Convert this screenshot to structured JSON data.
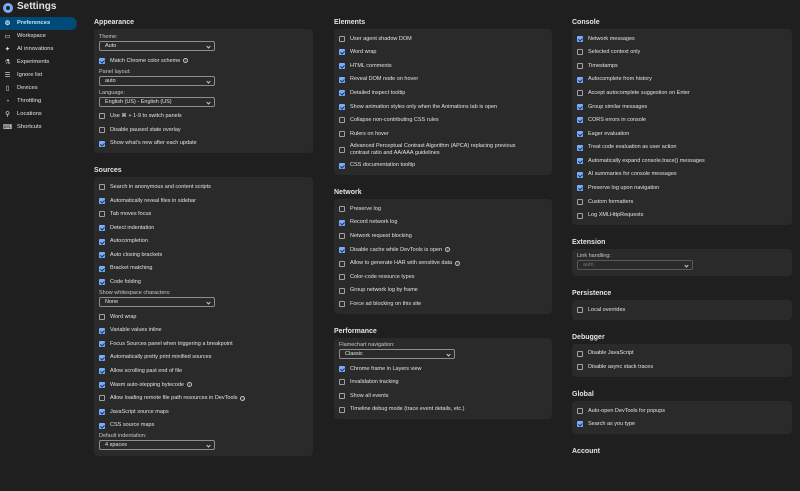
{
  "header": {
    "title": "Settings"
  },
  "sidebar": {
    "items": [
      {
        "label": "Preferences",
        "icon": "gear-icon",
        "glyph": "⚙"
      },
      {
        "label": "Workspace",
        "icon": "folder-icon",
        "glyph": "▭"
      },
      {
        "label": "AI innovations",
        "icon": "sparkle-icon",
        "glyph": "✦"
      },
      {
        "label": "Experiments",
        "icon": "flask-icon",
        "glyph": "⚗"
      },
      {
        "label": "Ignore list",
        "icon": "list-icon",
        "glyph": "☰"
      },
      {
        "label": "Devices",
        "icon": "devices-icon",
        "glyph": "▯"
      },
      {
        "label": "Throttling",
        "icon": "speedometer-icon",
        "glyph": "◔"
      },
      {
        "label": "Locations",
        "icon": "pin-icon",
        "glyph": "⚲"
      },
      {
        "label": "Shortcuts",
        "icon": "keyboard-icon",
        "glyph": "⌨"
      }
    ]
  },
  "appearance": {
    "title": "Appearance",
    "theme_label": "Theme:",
    "theme_value": "Auto",
    "match_chrome": "Match Chrome color scheme",
    "panel_layout_label": "Panel layout:",
    "panel_layout_value": "auto",
    "language_label": "Language:",
    "language_value": "English (US) - English (US)",
    "items": [
      {
        "label": "Use ⌘ + 1-9 to switch panels",
        "checked": false
      },
      {
        "label": "Disable paused state overlay",
        "checked": false
      },
      {
        "label": "Show what's new after each update",
        "checked": true
      }
    ]
  },
  "sources": {
    "title": "Sources",
    "items": [
      {
        "label": "Search in anonymous and content scripts",
        "checked": false
      },
      {
        "label": "Automatically reveal files in sidebar",
        "checked": true
      },
      {
        "label": "Tab moves focus",
        "checked": false
      },
      {
        "label": "Detect indentation",
        "checked": true
      },
      {
        "label": "Autocompletion",
        "checked": true
      },
      {
        "label": "Auto closing brackets",
        "checked": true
      },
      {
        "label": "Bracket matching",
        "checked": true
      },
      {
        "label": "Code folding",
        "checked": true
      }
    ],
    "whitespace_label": "Show whitespace characters:",
    "whitespace_value": "None",
    "items2": [
      {
        "label": "Word wrap",
        "checked": false
      },
      {
        "label": "Variable values inline",
        "checked": true
      },
      {
        "label": "Focus Sources panel when triggering a breakpoint",
        "checked": true
      },
      {
        "label": "Automatically pretty print minified sources",
        "checked": true
      },
      {
        "label": "Allow scrolling past end of file",
        "checked": true
      }
    ],
    "wasm": "Wasm auto-stepping bytecode",
    "remote": "Allow loading remote file path resources in DevTools",
    "items3": [
      {
        "label": "JavaScript source maps",
        "checked": true
      },
      {
        "label": "CSS source maps",
        "checked": true
      }
    ],
    "indent_label": "Default indentation:",
    "indent_value": "4 spaces"
  },
  "elements": {
    "title": "Elements",
    "items": [
      {
        "label": "User agent shadow DOM",
        "checked": false
      },
      {
        "label": "Word wrap",
        "checked": true
      },
      {
        "label": "HTML comments",
        "checked": true
      },
      {
        "label": "Reveal DOM node on hover",
        "checked": true
      },
      {
        "label": "Detailed inspect tooltip",
        "checked": true
      },
      {
        "label": "Show animation styles only when the Animations tab is open",
        "checked": true
      },
      {
        "label": "Collapse non-contributing CSS rules",
        "checked": false
      },
      {
        "label": "Rulers on hover",
        "checked": false
      }
    ],
    "apca": "Advanced Perceptual Contrast Algorithm (APCA) replacing previous contrast ratio and AA/AAA guidelines",
    "css_doc": "CSS documentation tooltip"
  },
  "network": {
    "title": "Network",
    "preserve": "Preserve log",
    "record": "Record network log",
    "blocking": "Network request blocking",
    "cache": "Disable cache while DevTools is open",
    "har": "Allow to generate HAR with sensitive data",
    "color": "Color-code resource types",
    "group": "Group network log by frame",
    "force": "Force ad blocking on this site"
  },
  "performance": {
    "title": "Performance",
    "flame_label": "Flamechart navigation:",
    "flame_value": "Classic",
    "items": [
      {
        "label": "Chrome frame in Layers view",
        "checked": true
      },
      {
        "label": "Invalidation tracking",
        "checked": false
      },
      {
        "label": "Show all events",
        "checked": false
      },
      {
        "label": "Timeline debug mode (trace event details, etc.)",
        "checked": false
      }
    ]
  },
  "console": {
    "title": "Console",
    "items": [
      {
        "label": "Network messages",
        "checked": true
      },
      {
        "label": "Selected context only",
        "checked": false
      },
      {
        "label": "Timestamps",
        "checked": false
      },
      {
        "label": "Autocomplete from history",
        "checked": true
      },
      {
        "label": "Accept autocomplete suggestion on Enter",
        "checked": false
      },
      {
        "label": "Group similar messages",
        "checked": true
      },
      {
        "label": "CORS errors in console",
        "checked": true
      },
      {
        "label": "Eager evaluation",
        "checked": true
      },
      {
        "label": "Treat code evaluation as user action",
        "checked": true
      },
      {
        "label": "Automatically expand console.trace() messages",
        "checked": true
      },
      {
        "label": "AI summaries for console messages",
        "checked": true
      },
      {
        "label": "Preserve log upon navigation",
        "checked": true
      },
      {
        "label": "Custom formatters",
        "checked": false
      },
      {
        "label": "Log XMLHttpRequests",
        "checked": false
      }
    ]
  },
  "extension": {
    "title": "Extension",
    "link_label": "Link handling:",
    "link_value": "auto"
  },
  "persistence": {
    "title": "Persistence",
    "local": "Local overrides"
  },
  "debugger": {
    "title": "Debugger",
    "js": "Disable JavaScript",
    "stack": "Disable async stack traces"
  },
  "global": {
    "title": "Global",
    "auto": "Auto-open DevTools for popups",
    "search": "Search as you type"
  },
  "account": {
    "title": "Account"
  }
}
